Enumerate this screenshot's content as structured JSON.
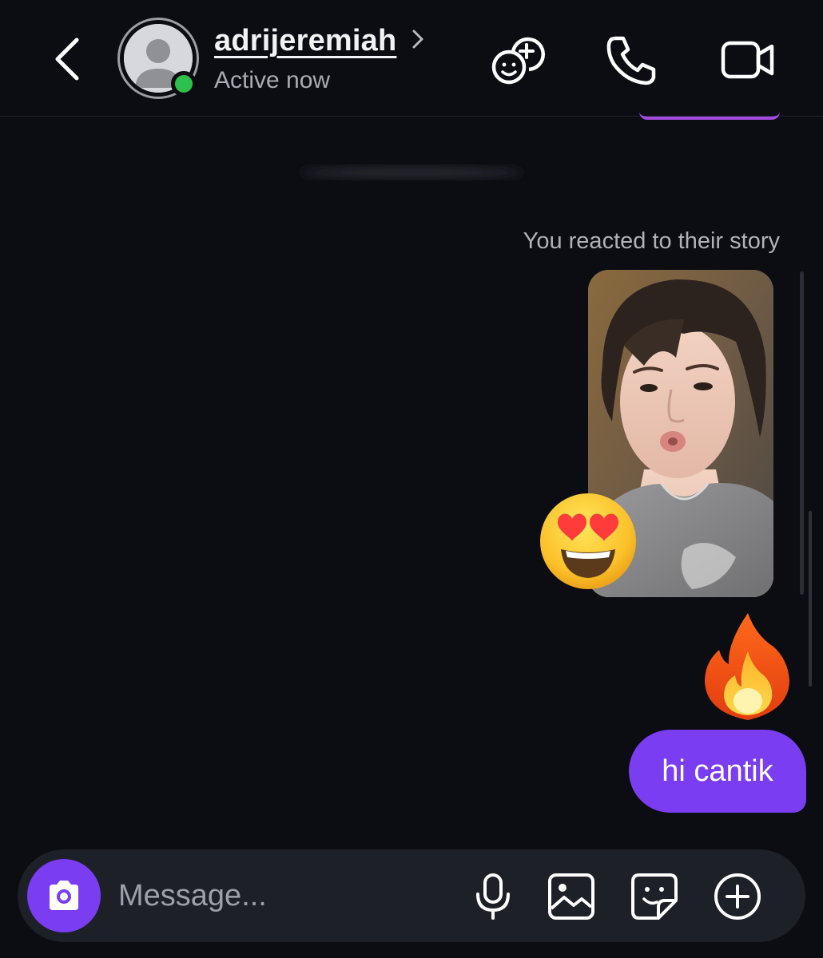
{
  "header": {
    "username": "adrijeremiah",
    "status": "Active now",
    "icons": [
      "back-chevron-icon",
      "avatar-placeholder-icon",
      "chevron-right-icon",
      "add-friends-icon",
      "phone-icon",
      "video-camera-icon"
    ]
  },
  "thread": {
    "story_reaction_label": "You reacted to their story",
    "story_reaction_emoji": "smiling-face-with-heart-eyes",
    "sent_emoji": "fire",
    "sent_text": "hi cantik"
  },
  "composer": {
    "placeholder": "Message...",
    "icons": [
      "camera-icon",
      "microphone-icon",
      "gallery-icon",
      "sticker-icon",
      "plus-icon"
    ]
  },
  "colors": {
    "background": "#0b0d12",
    "accent": "#7a3df2",
    "online": "#2ec04c",
    "composer_bg": "#1d2026"
  }
}
